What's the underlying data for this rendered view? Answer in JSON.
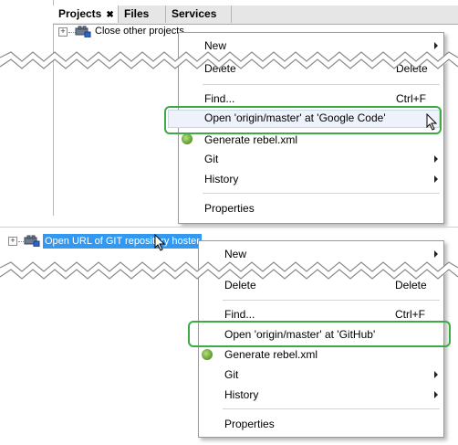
{
  "top": {
    "tabs": [
      {
        "label": "Projects",
        "close": "✖"
      },
      {
        "label": "Files"
      },
      {
        "label": "Services"
      }
    ],
    "tree_item": "Close other projects",
    "menu": {
      "new": "New",
      "delete": "Delete",
      "delete_shortcut": "Delete",
      "find": "Find...",
      "find_shortcut": "Ctrl+F",
      "open_remote": "Open 'origin/master' at 'Google Code'",
      "generate": "Generate rebel.xml",
      "git": "Git",
      "history": "History",
      "properties": "Properties"
    }
  },
  "bottom": {
    "tree_item": "Open URL of GIT repository hoster",
    "menu": {
      "new": "New",
      "delete": "Delete",
      "delete_shortcut": "Delete",
      "find": "Find...",
      "find_shortcut": "Ctrl+F",
      "open_remote": "Open 'origin/master' at 'GitHub'",
      "generate": "Generate rebel.xml",
      "git": "Git",
      "history": "History",
      "properties": "Properties"
    }
  },
  "colors": {
    "highlight_ring": "#3eaa45",
    "selection": "#3398f0",
    "refresh_icon": "#6ea83a"
  }
}
